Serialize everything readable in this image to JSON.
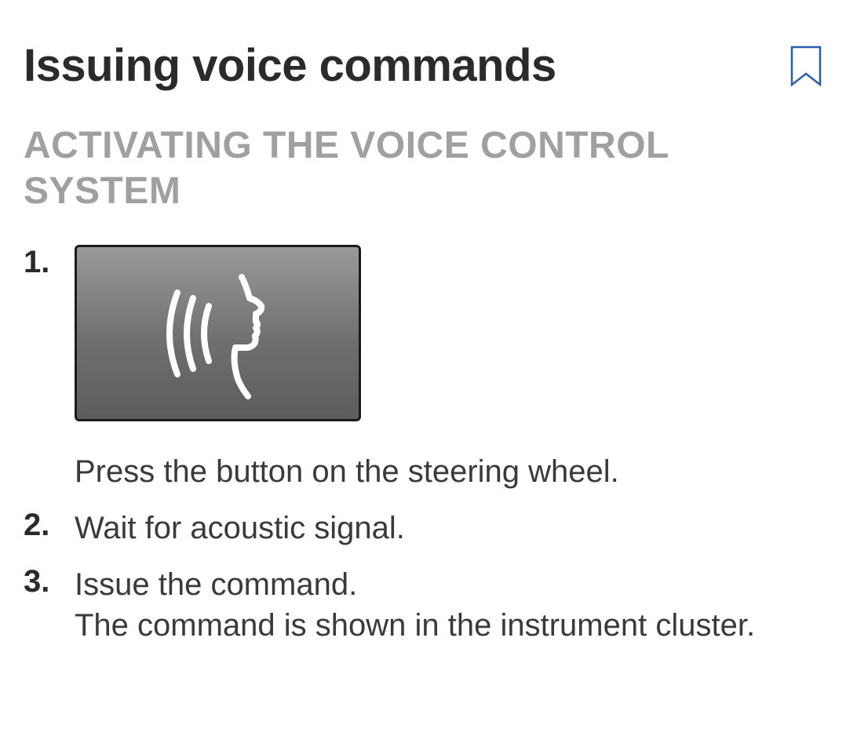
{
  "page": {
    "title": "Issuing voice commands"
  },
  "section": {
    "heading": "ACTIVATING THE VOICE CONTROL SYSTEM"
  },
  "steps": [
    {
      "num": "1",
      "text": "Press the button on the steering wheel.",
      "has_image": true
    },
    {
      "num": "2",
      "text": "Wait for acoustic signal."
    },
    {
      "num": "3",
      "text": "Issue the command.",
      "note": "The command is shown in the instrument cluster."
    }
  ]
}
